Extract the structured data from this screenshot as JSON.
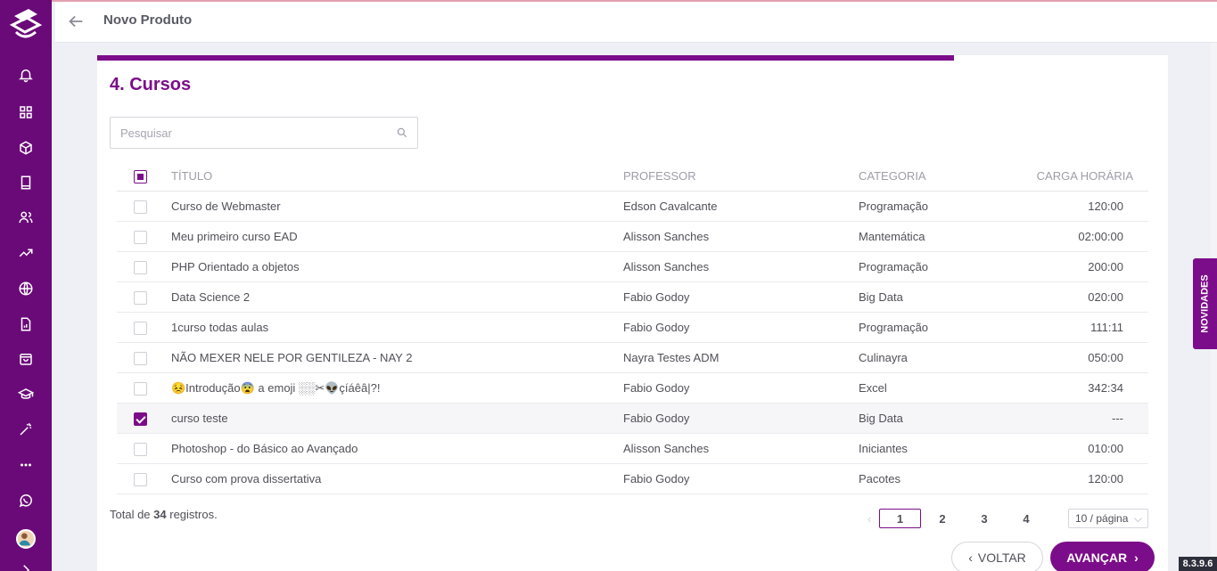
{
  "header": {
    "title": "Novo Produto"
  },
  "step": {
    "title": "4. Cursos",
    "progress": 0.8
  },
  "search": {
    "placeholder": "Pesquisar"
  },
  "table": {
    "columns": [
      "TÍTULO",
      "PROFESSOR",
      "CATEGORIA",
      "CARGA HORÁRIA"
    ],
    "rows": [
      {
        "title": "Curso de Webmaster",
        "professor": "Edson Cavalcante",
        "category": "Programação",
        "hours": "120:00",
        "checked": false
      },
      {
        "title": "Meu primeiro curso EAD",
        "professor": "Alisson Sanches",
        "category": "Mantemática",
        "hours": "02:00:00",
        "checked": false
      },
      {
        "title": "PHP Orientado a objetos",
        "professor": "Alisson Sanches",
        "category": "Programação",
        "hours": "200:00",
        "checked": false
      },
      {
        "title": "Data Science 2",
        "professor": "Fabio Godoy",
        "category": "Big Data",
        "hours": "020:00",
        "checked": false
      },
      {
        "title": "1curso todas aulas",
        "professor": "Fabio Godoy",
        "category": "Programação",
        "hours": "111:11",
        "checked": false
      },
      {
        "title": "NÃO MEXER NELE POR GENTILEZA - NAY 2",
        "professor": "Nayra Testes ADM",
        "category": "Culinayra",
        "hours": "050:00",
        "checked": false
      },
      {
        "title": "😣Introdução😨 a emoji ░░✂👽çíáêâ|?!",
        "professor": "Fabio Godoy",
        "category": "Excel",
        "hours": "342:34",
        "checked": false
      },
      {
        "title": "curso teste",
        "professor": "Fabio Godoy",
        "category": "Big Data",
        "hours": "---",
        "checked": true
      },
      {
        "title": "Photoshop - do Básico ao Avançado",
        "professor": "Alisson Sanches",
        "category": "Iniciantes",
        "hours": "010:00",
        "checked": false
      },
      {
        "title": "Curso com prova dissertativa",
        "professor": "Fabio Godoy",
        "category": "Pacotes",
        "hours": "120:00",
        "checked": false
      }
    ]
  },
  "footer": {
    "total_prefix": "Total de ",
    "total_count": "34",
    "total_suffix": " registros.",
    "pages": [
      "1",
      "2",
      "3",
      "4"
    ],
    "per_page": "10 / página"
  },
  "buttons": {
    "back": "VOLTAR",
    "next": "AVANÇAR"
  },
  "side_tab": "NOVIDADES",
  "version": "8.3.9.6",
  "colors": {
    "brand": "#7c0d8a",
    "sidebar": "#6a0a78"
  },
  "sidebar_icons": [
    "bell-icon",
    "grid-icon",
    "box-icon",
    "book-icon",
    "users-icon",
    "trending-icon",
    "globe-icon",
    "report-icon",
    "bag-icon",
    "graduation-icon",
    "magic-wand-icon",
    "more-icon",
    "whatsapp-icon"
  ]
}
